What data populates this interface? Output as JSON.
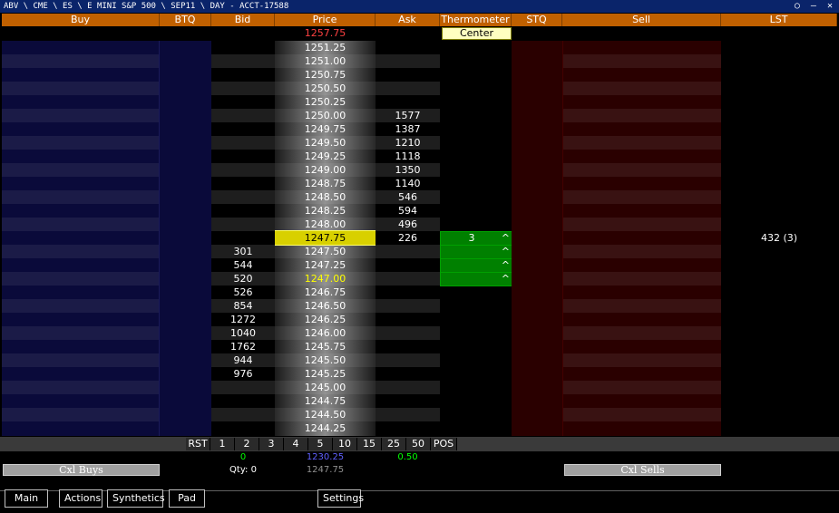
{
  "window": {
    "title": "ABV \\ CME \\ ES \\ E MINI S&P 500 \\ SEP11 \\ DAY - ACCT-17588",
    "controls": "○ – ✕"
  },
  "headers": {
    "buy": "Buy",
    "btq": "BTQ",
    "bid": "Bid",
    "price": "Price",
    "ask": "Ask",
    "thermometer": "Thermometer",
    "stq": "STQ",
    "sell": "Sell",
    "lst": "LST"
  },
  "top": {
    "high_price": "1257.75",
    "center_button": "Center"
  },
  "ladder": {
    "prices": [
      "1251.25",
      "1251.00",
      "1250.75",
      "1250.50",
      "1250.25",
      "1250.00",
      "1249.75",
      "1249.50",
      "1249.25",
      "1249.00",
      "1248.75",
      "1248.50",
      "1248.25",
      "1248.00",
      "1247.75",
      "1247.50",
      "1247.25",
      "1247.00",
      "1246.75",
      "1246.50",
      "1246.25",
      "1246.00",
      "1245.75",
      "1245.50",
      "1245.25",
      "1245.00",
      "1244.75",
      "1244.50",
      "1244.25"
    ],
    "asks": [
      "",
      "",
      "",
      "",
      "",
      "1577",
      "1387",
      "1210",
      "1118",
      "1350",
      "1140",
      "546",
      "594",
      "496",
      "226",
      "",
      "",
      "",
      "",
      "",
      "",
      "",
      "",
      "",
      "",
      "",
      "",
      "",
      ""
    ],
    "bids": [
      "",
      "",
      "",
      "",
      "",
      "",
      "",
      "",
      "",
      "",
      "",
      "",
      "",
      "",
      "",
      "301",
      "544",
      "520",
      "526",
      "854",
      "1272",
      "1040",
      "1762",
      "944",
      "976",
      "",
      "",
      "",
      ""
    ],
    "last_price_index": 14,
    "highlight_index": 17
  },
  "thermometer": {
    "bars": [
      {
        "label": "3",
        "caret": "^"
      },
      {
        "label": "",
        "caret": "^"
      },
      {
        "label": "",
        "caret": "^"
      },
      {
        "label": "",
        "caret": "^"
      }
    ],
    "start_index": 14
  },
  "lst": {
    "value": "432 (3)",
    "row_index": 14
  },
  "qty_buttons": [
    "RST",
    "1",
    "2",
    "3",
    "4",
    "5",
    "10",
    "15",
    "25",
    "50",
    "POS"
  ],
  "status": {
    "position": "0",
    "avg_price": "1230.25",
    "pnl": "0.50",
    "qty": "Qty: 0",
    "last": "1247.75"
  },
  "buttons": {
    "cxl_buys": "Cxl Buys",
    "cxl_sells": "Cxl Sells",
    "main": "Main",
    "actions": "Actions",
    "synthetics": "Synthetics",
    "pad": "Pad",
    "settings": "Settings"
  }
}
